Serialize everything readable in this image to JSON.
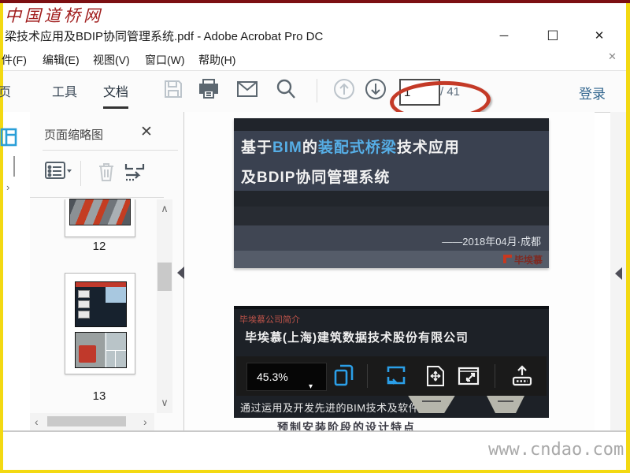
{
  "frame": {
    "top_color": "#7c0f12",
    "edge_color": "#f3d912"
  },
  "watermarks": {
    "top_left": "中国道桥网",
    "bottom_right": "www.cndao.com"
  },
  "window": {
    "title": "梁技术应用及BDIP协同管理系统.pdf - Adobe Acrobat Pro DC",
    "minimize": "─",
    "maximize": "☐",
    "close": "✕",
    "menu_close": "✕"
  },
  "menubar": {
    "items": {
      "file": "件(F)",
      "edit": "编辑(E)",
      "view": "视图(V)",
      "window": "窗口(W)",
      "help": "帮助(H)"
    }
  },
  "toolbar": {
    "tab_home": "页",
    "tab_tools": "工具",
    "tab_document": "文档",
    "page_value": "1",
    "page_total": "/ 41",
    "signin_label": "登录"
  },
  "glyphs": {
    "up": "∧",
    "down": "∨",
    "left": "‹",
    "right": "›",
    "caret_down": "▾",
    "chevron": "›"
  },
  "thumb_panel": {
    "title": "页面缩略图",
    "page12_label": "12",
    "page13_label": "13"
  },
  "doc": {
    "slide1": {
      "t1": "基于",
      "t2": "BIM",
      "t3": "的",
      "t4": "装配式桥梁",
      "t5": "技术应用",
      "line2": "及BDIP协同管理系统",
      "date": "——2018年04月·成都",
      "logo": "毕埃慕"
    },
    "slide2": {
      "section_label": "毕埃慕公司简介",
      "company": "毕埃慕(上海)建筑数据技术股份有限公司",
      "zoom_level": "45.3%",
      "body_text": "通过运用及开发先进的BIM技术及软件系统"
    },
    "fragment": "预制安装阶段的设计特点"
  },
  "colors": {
    "accent_blue": "#56aee6",
    "hud_icon_blue": "#2b9fe8",
    "annotation_red": "#c43a27",
    "signin_blue": "#33678f"
  }
}
